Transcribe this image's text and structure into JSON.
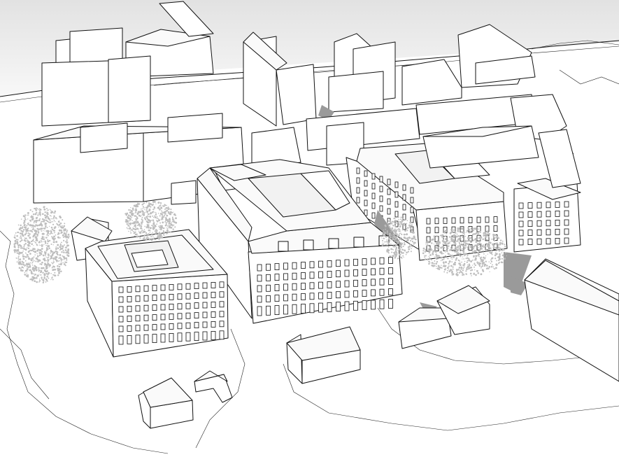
{
  "scene": {
    "style": "white massing model, black outlines, grey shadows",
    "colors": {
      "sky_top": "#e4e4e4",
      "sky_bottom": "#f7f7f7",
      "outline": "#111111",
      "shadow": "#9a9a9a",
      "tree": "#bdbdbd"
    }
  }
}
